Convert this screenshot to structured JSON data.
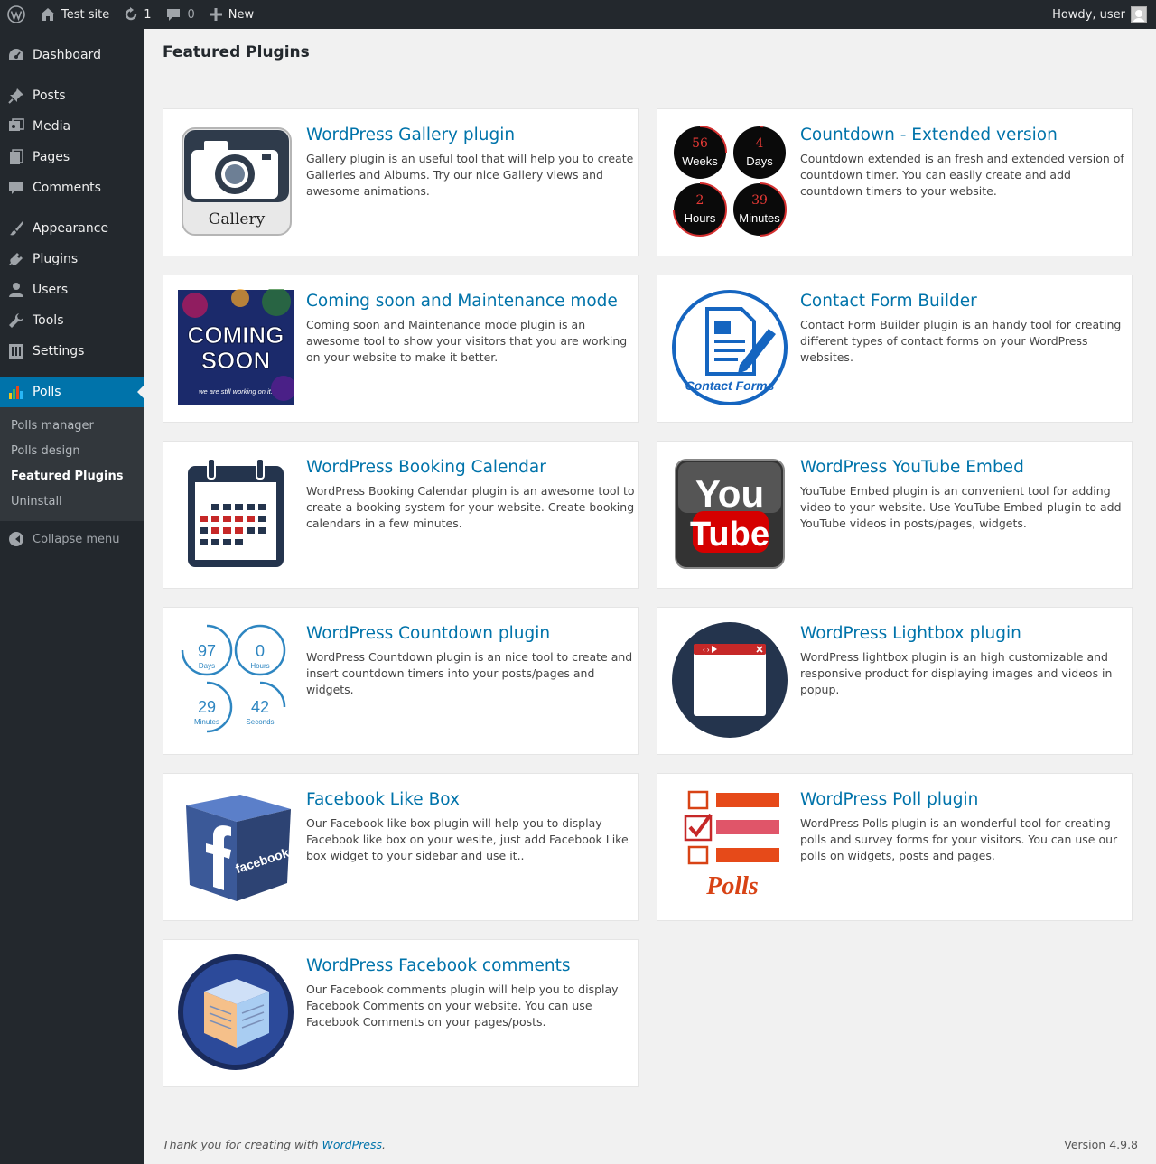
{
  "adminbar": {
    "site_name": "Test site",
    "updates_count": "1",
    "comments_count": "0",
    "new_label": "New",
    "howdy": "Howdy, user"
  },
  "sidebar": {
    "items": [
      {
        "label": "Dashboard",
        "icon": "dashboard-icon"
      },
      {
        "label": "Posts",
        "icon": "pin-icon"
      },
      {
        "label": "Media",
        "icon": "media-icon"
      },
      {
        "label": "Pages",
        "icon": "pages-icon"
      },
      {
        "label": "Comments",
        "icon": "comment-icon"
      },
      {
        "label": "Appearance",
        "icon": "brush-icon"
      },
      {
        "label": "Plugins",
        "icon": "plug-icon"
      },
      {
        "label": "Users",
        "icon": "user-icon"
      },
      {
        "label": "Tools",
        "icon": "wrench-icon"
      },
      {
        "label": "Settings",
        "icon": "settings-icon"
      },
      {
        "label": "Polls",
        "icon": "chart-icon"
      }
    ],
    "submenu": [
      "Polls manager",
      "Polls design",
      "Featured Plugins",
      "Uninstall"
    ],
    "collapse_label": "Collapse menu"
  },
  "page": {
    "title": "Featured Plugins"
  },
  "plugins": [
    {
      "title": "WordPress Gallery plugin",
      "desc": "Gallery plugin is an useful tool that will help you to create Galleries and Albums. Try our nice Gallery views and awesome animations.",
      "icon_text": "Gallery"
    },
    {
      "title": "Countdown - Extended version",
      "desc": "Countdown extended is an fresh and extended version of countdown timer. You can easily create and add countdown timers to your website.",
      "icon_values": [
        "56",
        "4",
        "2",
        "39"
      ],
      "icon_labels": [
        "Weeks",
        "Days",
        "Hours",
        "Minutes"
      ]
    },
    {
      "title": "Coming soon and Maintenance mode",
      "desc": "Coming soon and Maintenance mode plugin is an awesome tool to show your visitors that you are working on your website to make it better.",
      "icon_text": "COMING SOON",
      "icon_sub": "we are still working on it."
    },
    {
      "title": "Contact Form Builder",
      "desc": "Contact Form Builder plugin is an handy tool for creating different types of contact forms on your WordPress websites.",
      "icon_text": "Contact Forms"
    },
    {
      "title": "WordPress Booking Calendar",
      "desc": "WordPress Booking Calendar plugin is an awesome tool to create a booking system for your website. Create booking calendars in a few minutes."
    },
    {
      "title": "WordPress YouTube Embed",
      "desc": "YouTube Embed plugin is an convenient tool for adding video to your website. Use YouTube Embed plugin to add YouTube videos in posts/pages, widgets.",
      "icon_text_1": "You",
      "icon_text_2": "Tube"
    },
    {
      "title": "WordPress Countdown plugin",
      "desc": "WordPress Countdown plugin is an nice tool to create and insert countdown timers into your posts/pages and widgets.",
      "icon_values": [
        "97",
        "0",
        "29",
        "42"
      ],
      "icon_labels": [
        "Days",
        "Hours",
        "Minutes",
        "Seconds"
      ]
    },
    {
      "title": "WordPress Lightbox plugin",
      "desc": "WordPress lightbox plugin is an high customizable and responsive product for displaying images and videos in popup."
    },
    {
      "title": "Facebook Like Box",
      "desc": "Our Facebook like box plugin will help you to display Facebook like box on your wesite, just add Facebook Like box widget to your sidebar and use it..",
      "icon_text": "facebook"
    },
    {
      "title": "WordPress Poll plugin",
      "desc": "WordPress Polls plugin is an wonderful tool for creating polls and survey forms for your visitors. You can use our polls on widgets, posts and pages.",
      "icon_text": "Polls"
    },
    {
      "title": "WordPress Facebook comments",
      "desc": "Our Facebook comments plugin will help you to display Facebook Comments on your website. You can use Facebook Comments on your pages/posts."
    }
  ],
  "footer": {
    "thanks_prefix": "Thank you for creating with ",
    "thanks_link": "WordPress",
    "thanks_suffix": ".",
    "version": "Version 4.9.8"
  },
  "colors": {
    "adminbar": "#23282d",
    "accent": "#0073aa",
    "submenu_bg": "#32373c",
    "background": "#f1f1f1"
  }
}
